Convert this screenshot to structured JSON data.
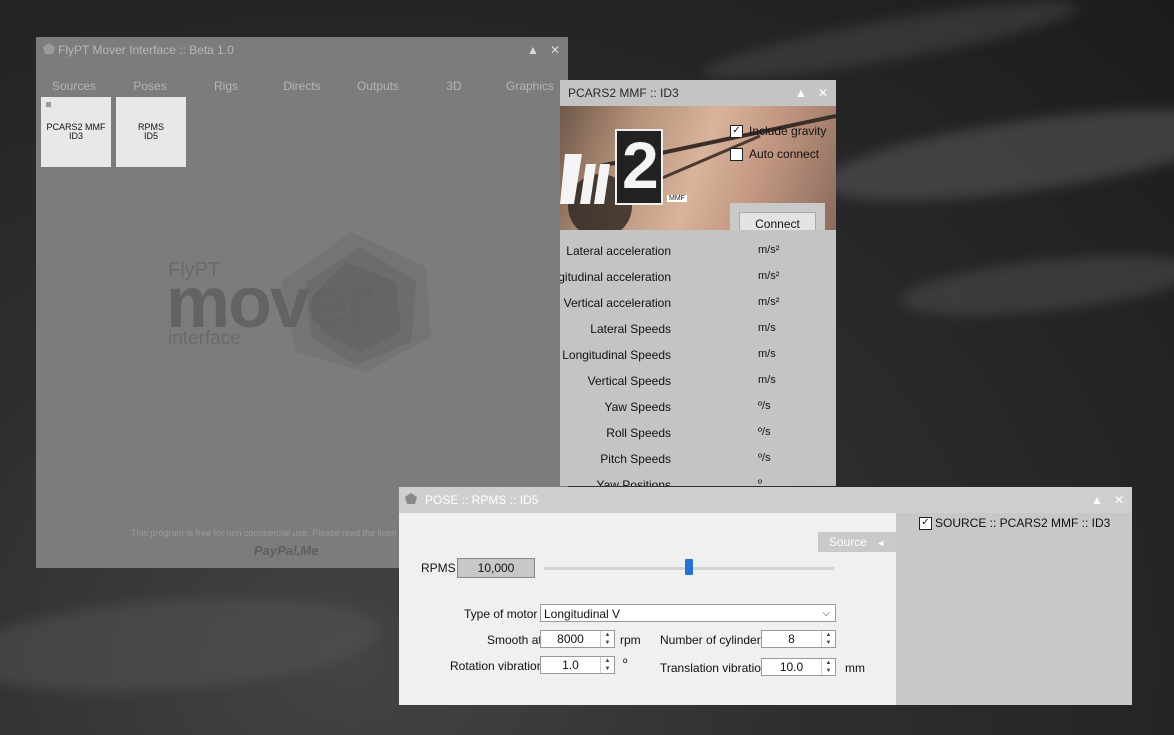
{
  "main_window": {
    "title": "FlyPT Mover Interface :: Beta 1.0",
    "tabs": [
      "Sources",
      "Poses",
      "Rigs",
      "Directs",
      "Outputs",
      "3D",
      "Graphics"
    ],
    "tiles": [
      {
        "line1": "PCARS2 MMF",
        "line2": "ID3"
      },
      {
        "line1": "RPMS",
        "line2": "ID5"
      }
    ],
    "watermark": {
      "top": "FlyPT",
      "middle": "mover",
      "bottom": "interface"
    },
    "footer": "This program is free for non commercial use. Please read the licen",
    "paypal": "PayPal.Me"
  },
  "pcars_window": {
    "title": "PCARS2 MMF :: ID3",
    "include_gravity": {
      "label": "Include gravity",
      "checked": true
    },
    "auto_connect": {
      "label": "Auto connect",
      "checked": false
    },
    "connect_label": "Connect",
    "banner_number": "2",
    "banner_badge": "MMF",
    "measurements": [
      {
        "label": "Lateral acceleration",
        "unit": "m/s²"
      },
      {
        "label": "Longitudinal acceleration",
        "unit": "m/s²"
      },
      {
        "label": "Vertical acceleration",
        "unit": "m/s²"
      },
      {
        "label": "Lateral Speeds",
        "unit": "m/s"
      },
      {
        "label": "Longitudinal Speeds",
        "unit": "m/s"
      },
      {
        "label": "Vertical Speeds",
        "unit": "m/s"
      },
      {
        "label": "Yaw Speeds",
        "unit": "º/s"
      },
      {
        "label": "Roll Speeds",
        "unit": "º/s"
      },
      {
        "label": "Pitch Speeds",
        "unit": "º/s"
      },
      {
        "label": "Yaw Positions",
        "unit": "º"
      }
    ]
  },
  "pose_window": {
    "title": "POSE :: RPMS :: ID5",
    "source_tab": "Source",
    "source_arrow": "◄",
    "rpms_label": "RPMS",
    "rpms_value": "10,000",
    "rpms_slider_fraction": 0.5,
    "type_of_motor_label": "Type of motor",
    "type_of_motor_value": "Longitudinal V",
    "smooth_at_label": "Smooth at",
    "smooth_at_value": "8000",
    "smooth_at_unit": "rpm",
    "cylinders_label": "Number of cylinders",
    "cylinders_value": "8",
    "rotation_label": "Rotation  vibration",
    "rotation_value": "1.0",
    "rotation_unit": "º",
    "translation_label": "Translation  vibration",
    "translation_value": "10.0",
    "translation_unit": "mm",
    "source_item": {
      "label": "SOURCE :: PCARS2 MMF :: ID3",
      "checked": true
    }
  },
  "icons": {
    "maximize": "▲",
    "close": "✕",
    "dropdown": "⌵",
    "spin_up": "▲",
    "spin_down": "▼",
    "check": "✓"
  }
}
